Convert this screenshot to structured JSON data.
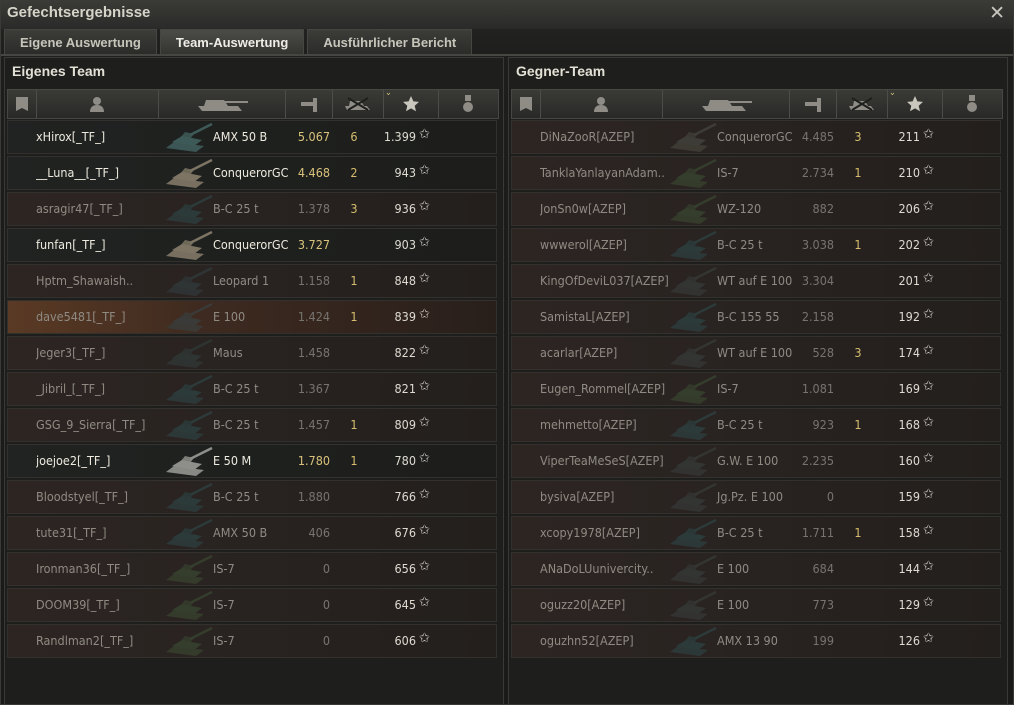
{
  "window": {
    "title": "Gefechtsergebnisse",
    "close_glyph": "✕"
  },
  "tabs": [
    {
      "label": "Eigene Auswertung",
      "active": false
    },
    {
      "label": "Team-Auswertung",
      "active": true
    },
    {
      "label": "Ausführlicher Bericht",
      "active": false
    }
  ],
  "columns": [
    "squad-icon",
    "player-icon",
    "tank-icon",
    "damage-icon",
    "kills-icon",
    "xp-star-icon",
    "medal-icon"
  ],
  "star_glyph": "✩",
  "own_team": {
    "title": "Eigenes Team",
    "players": [
      {
        "name": "xHirox[_TF_]",
        "vehicle": "AMX 50 B",
        "damage": "5.067",
        "kills": "6",
        "xp": "1.399",
        "alive": true,
        "self": false,
        "tank_color": "#3e5a58"
      },
      {
        "name": "__Luna__[_TF_]",
        "vehicle": "ConquerorGC",
        "damage": "4.468",
        "kills": "2",
        "xp": "943",
        "alive": true,
        "self": false,
        "tank_color": "#7d7464"
      },
      {
        "name": "asragir47[_TF_]",
        "vehicle": "B-C 25 t",
        "damage": "1.378",
        "kills": "3",
        "xp": "936",
        "alive": false,
        "self": false,
        "tank_color": "#2c3a3a"
      },
      {
        "name": "funfan[_TF_]",
        "vehicle": "ConquerorGC",
        "damage": "3.727",
        "kills": "",
        "xp": "903",
        "alive": true,
        "self": false,
        "tank_color": "#7d7464"
      },
      {
        "name": "Hptm_Shawaish..",
        "vehicle": "Leopard 1",
        "damage": "1.158",
        "kills": "1",
        "xp": "848",
        "alive": false,
        "self": false,
        "tank_color": "#2f3434"
      },
      {
        "name": "dave5481[_TF_]",
        "vehicle": "E 100",
        "damage": "1.424",
        "kills": "1",
        "xp": "839",
        "alive": false,
        "self": true,
        "tank_color": "#3a3a38"
      },
      {
        "name": "Jeger3[_TF_]",
        "vehicle": "Maus",
        "damage": "1.458",
        "kills": "",
        "xp": "822",
        "alive": false,
        "self": false,
        "tank_color": "#2e3432"
      },
      {
        "name": "_Jibril_[_TF_]",
        "vehicle": "B-C 25 t",
        "damage": "1.367",
        "kills": "",
        "xp": "821",
        "alive": false,
        "self": false,
        "tank_color": "#2c3a3a"
      },
      {
        "name": "GSG_9_Sierra[_TF_]",
        "vehicle": "B-C 25 t",
        "damage": "1.457",
        "kills": "1",
        "xp": "809",
        "alive": false,
        "self": false,
        "tank_color": "#2c3a3a"
      },
      {
        "name": "joejoe2[_TF_]",
        "vehicle": "E 50 M",
        "damage": "1.780",
        "kills": "1",
        "xp": "780",
        "alive": true,
        "self": false,
        "tank_color": "#8e8e8a"
      },
      {
        "name": "Bloodstyel[_TF_]",
        "vehicle": "B-C 25 t",
        "damage": "1.880",
        "kills": "",
        "xp": "766",
        "alive": false,
        "self": false,
        "tank_color": "#2c3a3a"
      },
      {
        "name": "tute31[_TF_]",
        "vehicle": "AMX 50 B",
        "damage": "406",
        "kills": "",
        "xp": "676",
        "alive": false,
        "self": false,
        "tank_color": "#2c3a3a"
      },
      {
        "name": "Ironman36[_TF_]",
        "vehicle": "IS-7",
        "damage": "0",
        "kills": "",
        "xp": "656",
        "alive": false,
        "self": false,
        "tank_color": "#353d2c"
      },
      {
        "name": "DOOM39[_TF_]",
        "vehicle": "IS-7",
        "damage": "0",
        "kills": "",
        "xp": "645",
        "alive": false,
        "self": false,
        "tank_color": "#353d2c"
      },
      {
        "name": "Randlman2[_TF_]",
        "vehicle": "IS-7",
        "damage": "0",
        "kills": "",
        "xp": "606",
        "alive": false,
        "self": false,
        "tank_color": "#353d2c"
      }
    ]
  },
  "enemy_team": {
    "title": "Gegner-Team",
    "players": [
      {
        "name": "DiNaZooR[AZEP]",
        "vehicle": "ConquerorGC",
        "damage": "4.485",
        "kills": "3",
        "xp": "211",
        "alive": false,
        "self": false,
        "tank_color": "#3e3c36"
      },
      {
        "name": "TanklaYanlayanAdam..",
        "vehicle": "IS-7",
        "damage": "2.734",
        "kills": "1",
        "xp": "210",
        "alive": false,
        "self": false,
        "tank_color": "#353d2c"
      },
      {
        "name": "JonSn0w[AZEP]",
        "vehicle": "WZ-120",
        "damage": "882",
        "kills": "",
        "xp": "206",
        "alive": false,
        "self": false,
        "tank_color": "#353d2c"
      },
      {
        "name": "wwwerol[AZEP]",
        "vehicle": "B-C 25 t",
        "damage": "3.038",
        "kills": "1",
        "xp": "202",
        "alive": false,
        "self": false,
        "tank_color": "#2c3a3a"
      },
      {
        "name": "KingOfDeviL037[AZEP]",
        "vehicle": "WT auf E 100",
        "damage": "3.304",
        "kills": "",
        "xp": "201",
        "alive": false,
        "self": false,
        "tank_color": "#333533"
      },
      {
        "name": "SamistaL[AZEP]",
        "vehicle": "B-C 155 55",
        "damage": "2.158",
        "kills": "",
        "xp": "192",
        "alive": false,
        "self": false,
        "tank_color": "#2c3a3a"
      },
      {
        "name": "acarlar[AZEP]",
        "vehicle": "WT auf E 100",
        "damage": "528",
        "kills": "3",
        "xp": "174",
        "alive": false,
        "self": false,
        "tank_color": "#333533"
      },
      {
        "name": "Eugen_Rommel[AZEP]",
        "vehicle": "IS-7",
        "damage": "1.081",
        "kills": "",
        "xp": "169",
        "alive": false,
        "self": false,
        "tank_color": "#353d2c"
      },
      {
        "name": "mehmetto[AZEP]",
        "vehicle": "B-C 25 t",
        "damage": "923",
        "kills": "1",
        "xp": "168",
        "alive": false,
        "self": false,
        "tank_color": "#2c3a3a"
      },
      {
        "name": "ViperTeaMeSeS[AZEP]",
        "vehicle": "G.W. E 100",
        "damage": "2.235",
        "kills": "",
        "xp": "160",
        "alive": false,
        "self": false,
        "tank_color": "#333533"
      },
      {
        "name": "bysiva[AZEP]",
        "vehicle": "Jg.Pz. E 100",
        "damage": "0",
        "kills": "",
        "xp": "159",
        "alive": false,
        "self": false,
        "tank_color": "#333533"
      },
      {
        "name": "xcopy1978[AZEP]",
        "vehicle": "B-C 25 t",
        "damage": "1.711",
        "kills": "1",
        "xp": "158",
        "alive": false,
        "self": false,
        "tank_color": "#2c3a3a"
      },
      {
        "name": "ANaDoLUunivercity..",
        "vehicle": "E 100",
        "damage": "684",
        "kills": "",
        "xp": "144",
        "alive": false,
        "self": false,
        "tank_color": "#333533"
      },
      {
        "name": "oguzz20[AZEP]",
        "vehicle": "E 100",
        "damage": "773",
        "kills": "",
        "xp": "129",
        "alive": false,
        "self": false,
        "tank_color": "#333533"
      },
      {
        "name": "oguzhn52[AZEP]",
        "vehicle": "AMX 13 90",
        "damage": "199",
        "kills": "",
        "xp": "126",
        "alive": false,
        "self": false,
        "tank_color": "#2c3a3a"
      }
    ]
  }
}
